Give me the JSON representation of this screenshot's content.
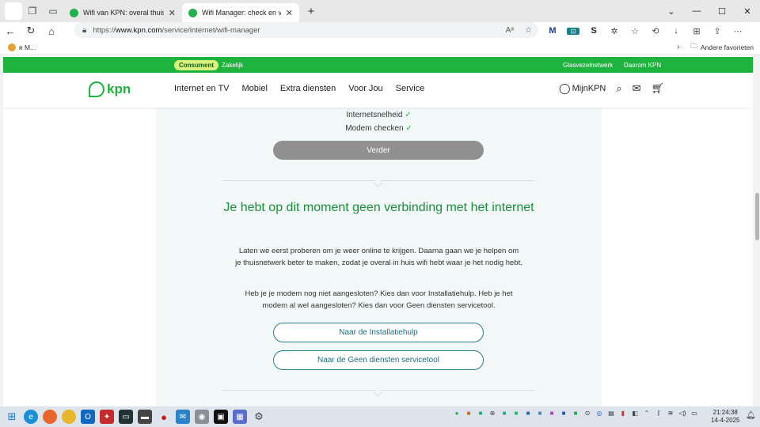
{
  "browser": {
    "tabs": [
      {
        "title": "Wifi van KPN: overal thuis stabiel",
        "active": false
      },
      {
        "title": "Wifi Manager: check en verbeter j",
        "active": true
      }
    ],
    "new_tab": "+",
    "url_scheme": "https://",
    "url_host": "www.kpn.com",
    "url_path": "/service/internet/wifi-manager",
    "favorites_other": "Andere favorieten",
    "favorite_item": "ʀ M..."
  },
  "kpn": {
    "topbar": {
      "consument": "Consument",
      "zakelijk": "Zakelijk",
      "glasvezel": "Glasvezelnetwerk",
      "daarom": "Daarom KPN"
    },
    "logo": "kpn",
    "nav": [
      "Internet en TV",
      "Mobiel",
      "Extra diensten",
      "Voor Jou",
      "Service"
    ],
    "mijn": "MijnKPN",
    "checks": [
      {
        "label": "Internetsnelheid",
        "tick": "✓"
      },
      {
        "label": "Modem checken",
        "tick": "✓"
      }
    ],
    "verder": "Verder",
    "heading": "Je hebt op dit moment geen verbinding met het internet",
    "para1": "Laten we eerst proberen om je weer online te krijgen. Daarna gaan we je helpen om je thuisnetwerk beter te maken, zodat je overal in huis wifi hebt waar je het nodig hebt.",
    "para2": "Heb je je modem nog niet aangesloten? Kies dan voor Installatiehulp. Heb je het modem al wel aangesloten? Kies dan voor Geen diensten servicetool.",
    "btn1": "Naar de Installatiehulp",
    "btn2": "Naar de Geen diensten servicetool"
  },
  "taskbar": {
    "time": "21:24:38",
    "date": "14-4-2025"
  },
  "colors": {
    "kpn_green": "#1db33d",
    "heading_green": "#1a8f3a",
    "button_teal": "#2a7d8f"
  }
}
